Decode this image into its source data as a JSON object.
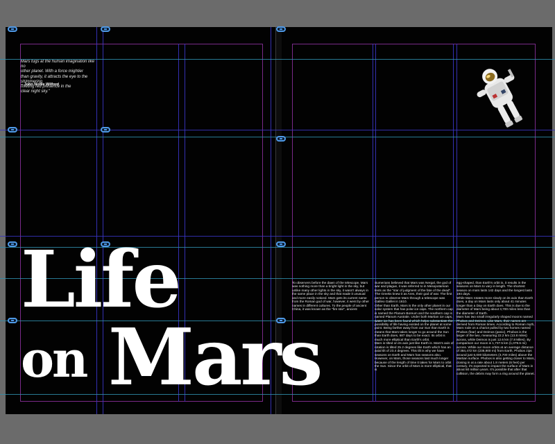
{
  "spread": {
    "background": "#020202",
    "canvas": "#6b6b6b"
  },
  "quote": {
    "text": "Mars tugs at the human imagination like no\nother planet. With a force mightier\nthan gravity, it attracts the eye to the shimmering\nriveting red presence in the\nclear night sky.\"",
    "author": "– John Noble Wilford"
  },
  "title": {
    "word1": "Life",
    "word2": "on",
    "word3": "Mars"
  },
  "body": {
    "col1": "To observers before the dawn of the telescope, Mars was nothing more than a bright light in the sky, but unlike many other lights in the sky, it wasn't always in the same place in the sky and that made it unusual and more easily noticed. Mars gets its current name from the Roman god of war, however, it went by other names in different cultures. To the people of ancient China, it was known as the \"fire star\", ancient",
    "col2": "Sumerians believed that Mars was Nergal, the god of war and plague, it was referred to in Mesopotamian texts as the \"star of judgment of the fate of the dead\". The Greeks knew it as Ares, their god of war. The first person to observe Mars through a telescope was Galileo Galilei in 1610.\n   Other than Earth, Mars is the only other planet in our solar system that has polar ice caps. The northern cap is named the Planum Boreum and the southern cap is named Planum Australe. Under both Martian ice caps, water ice has been found which helps substantiate the possibility of life having existed on the planet at some point. Being farther away from our Sun than Earth is means that Mars takes longer to go around the Sun than Earth does, 687 days to be exact. Its orbit is much more elliptical than Earth's orbit.\n   Mars is tilted on its axis just like Earth is. Mars's axis of rotation is tilted 25.2 degrees like Earth which has an axial tilt of 23.4 degrees. This tilt is why we have seasons on Earth and Mars has seasons also. However, on Mars, those seasons last much longer because of the length of time it takes for Mars to orbit the Sun. Since the orbit of Mars is more elliptical, that is",
    "col3": "egg-shaped, than Earth's orbit is, it results in the seasons on Mars to vary in length. The shortest season on mars lasts 142 days and the longest lasts 194 days.\n   While Mars rotates more slowly on its axis than Earth does, a day on Mars lasts only about 41 minutes longer than a Day on Earth does. This is due to the diameter of Mars being about 3,700 miles less than the diameter of Earth.\n   Mars has two small irregularly shaped moons named Phobos and Deimos. Like Mars, their names are derived from Roman times. According to Roman myth, Mars rode on a chariot pulled by two horses named Phobos (fear) and Deimos (panic). Phobos is the larger of the two, measuring 22.2 km (13.8 miles) across, while Deimos is just 12.6 km (7.8 Miles). By comparison our moon is 1,737.5 km (1,079.6 mi) across. While our moon orbits at an average distance of 384,472 km (238,900 mi) from Earth, Phobos zips around just 6,000 kilometers (3,700 miles) above the Martian surface. Phobos is also getting closer to Mars, closing in at a rate about 1.8 meters (6 feet) per century, it's expected to impact the surface of Mars in about 50 million years. It's possible that after that collision, the debris may form a ring around the planet."
  },
  "icons": {
    "astronaut": "astronaut-image",
    "link": "text-frame-link-icon"
  }
}
